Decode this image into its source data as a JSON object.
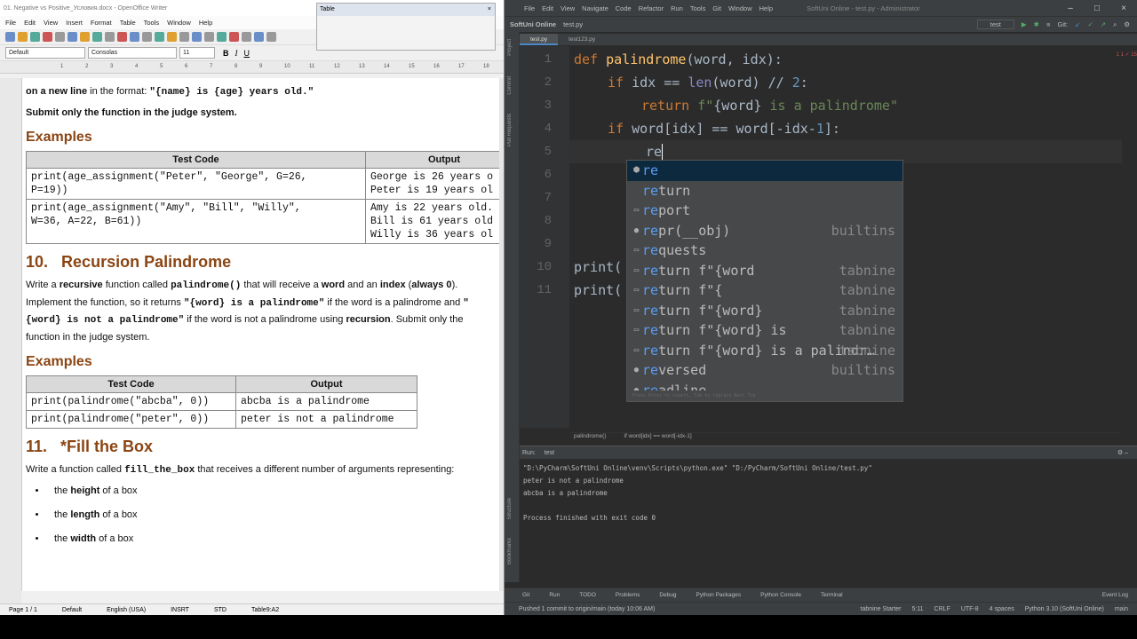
{
  "writer": {
    "title": "01. Negative vs Positive_Условия.docx - OpenOffice Writer",
    "menu": [
      "File",
      "Edit",
      "View",
      "Insert",
      "Format",
      "Table",
      "Tools",
      "Window",
      "Help"
    ],
    "style_box": "Default",
    "font_box": "Consolas",
    "size_box": "11",
    "table_toolbar_title": "Table",
    "doc": {
      "intro_a": "on a new line",
      "intro_b": " in the format: ",
      "intro_code": "\"{name} is {age} years old.\"",
      "submit1": "Submit only the function in the judge system.",
      "examples1": "Examples",
      "t1_head": [
        "Test Code",
        "Output"
      ],
      "t1_rows": [
        [
          "print(age_assignment(\"Peter\", \"George\", G=26,\nP=19))",
          "George is 26 years o\nPeter is 19 years ol"
        ],
        [
          "print(age_assignment(\"Amy\", \"Bill\", \"Willy\",\nW=36, A=22, B=61))",
          "Amy is 22 years old.\nBill is 61 years old\nWilly is 36 years ol"
        ]
      ],
      "h10_num": "10.",
      "h10_title": "Recursion Palindrome",
      "p10": [
        {
          "t": "Write a ",
          "c": ""
        },
        {
          "t": "recursive",
          "c": "b"
        },
        {
          "t": " function called ",
          "c": ""
        },
        {
          "t": "palindrome()",
          "c": "m"
        },
        {
          "t": " that will receive a ",
          "c": ""
        },
        {
          "t": "word",
          "c": "b"
        },
        {
          "t": " and an ",
          "c": ""
        },
        {
          "t": "index",
          "c": "b"
        },
        {
          "t": " (",
          "c": ""
        },
        {
          "t": "always 0",
          "c": "b"
        },
        {
          "t": "). Implement the function, so it returns ",
          "c": ""
        },
        {
          "t": "\"{word} is a palindrome\"",
          "c": "m"
        },
        {
          "t": " if the word is a palindrome and ",
          "c": ""
        },
        {
          "t": "\"{word} is not a palindrome\"",
          "c": "m"
        },
        {
          "t": " if the word is not a palindrome using ",
          "c": ""
        },
        {
          "t": "recursion",
          "c": "b"
        },
        {
          "t": ". Submit only the function in the judge system.",
          "c": ""
        }
      ],
      "examples2": "Examples",
      "t2_head": [
        "Test Code",
        "Output"
      ],
      "t2_rows": [
        [
          "print(palindrome(\"abcba\", 0))",
          "abcba is a palindrome"
        ],
        [
          "print(palindrome(\"peter\", 0))",
          "peter is not a palindrome"
        ]
      ],
      "h11_num": "11.",
      "h11_title": "*Fill the Box",
      "p11_a": "Write a function called ",
      "p11_code": "fill_the_box",
      "p11_b": " that receives a different number of arguments representing:",
      "bullets": [
        {
          "pre": "the ",
          "b": "height",
          "post": " of a box"
        },
        {
          "pre": "the ",
          "b": "length",
          "post": " of a box"
        },
        {
          "pre": "the ",
          "b": "width",
          "post": " of a box"
        }
      ]
    },
    "status": [
      "Page 1 / 1",
      "Default",
      "English (USA)",
      "INSRT",
      "STD",
      "Table9:A2"
    ]
  },
  "pycharm": {
    "menu": [
      "File",
      "Edit",
      "View",
      "Navigate",
      "Code",
      "Refactor",
      "Run",
      "Tools",
      "Git",
      "Window",
      "Help"
    ],
    "window_title": "SoftUni Online - test.py - Administrator",
    "project": "SoftUni Online",
    "file": "test.py",
    "run_config": "test",
    "git_label": "Git:",
    "tabs": [
      "test.py",
      "test123.py"
    ],
    "inspection": "1 1 ✓ 15",
    "gutter": [
      "1",
      "2",
      "3",
      "4",
      "5",
      "6",
      "7",
      "8",
      "9",
      "10",
      "11"
    ],
    "code": {
      "l1": [
        "def",
        "palindrome",
        "(word, idx):"
      ],
      "l2": [
        "if",
        " idx == ",
        "len",
        "(word) // ",
        "2",
        ":"
      ],
      "l3": [
        "return",
        " f\"",
        "{word}",
        " is a palindrome\""
      ],
      "l4": [
        "if",
        " word[idx] == word[-idx-",
        "1",
        "]:"
      ],
      "l5": "re",
      "l10": "print(",
      "l11": "print("
    },
    "completion": [
      {
        "icon": "⬢",
        "hl": "re",
        "rest": "",
        "src": ""
      },
      {
        "icon": "",
        "hl": "re",
        "rest": "turn",
        "src": ""
      },
      {
        "icon": "▭",
        "hl": "re",
        "rest": "port",
        "src": ""
      },
      {
        "icon": "●",
        "hl": "re",
        "rest": "pr(__obj)",
        "src": "builtins"
      },
      {
        "icon": "▭",
        "hl": "re",
        "rest": "quests",
        "src": ""
      },
      {
        "icon": "▭",
        "hl": "re",
        "rest": "turn f\"{word",
        "src": "tabnine"
      },
      {
        "icon": "▭",
        "hl": "re",
        "rest": "turn f\"{",
        "src": "tabnine"
      },
      {
        "icon": "▭",
        "hl": "re",
        "rest": "turn f\"{word}",
        "src": "tabnine"
      },
      {
        "icon": "▭",
        "hl": "re",
        "rest": "turn f\"{word} is",
        "src": "tabnine"
      },
      {
        "icon": "▭",
        "hl": "re",
        "rest": "turn f\"{word} is a palindr…",
        "src": "tabnine"
      },
      {
        "icon": "●",
        "hl": "re",
        "rest": "versed",
        "src": "builtins"
      },
      {
        "icon": "●",
        "hl": "re",
        "rest": "adline",
        "src": ""
      }
    ],
    "completion_footer": "Press Enter to insert, Tab to replace   Next Tip",
    "breadcrumb": [
      "palindrome()",
      "if word[idx] == word[-idx-1]"
    ],
    "run_label": "Run:",
    "run_tab": "test",
    "run_output": [
      "\"D:\\PyCharm\\SoftUni Online\\venv\\Scripts\\python.exe\" \"D:/PyCharm/SoftUni Online/test.py\"",
      "peter is not a palindrome",
      "abcba is a palindrome",
      "",
      "Process finished with exit code 0"
    ],
    "bottom_tabs": [
      "Git",
      "Run",
      "TODO",
      "Problems",
      "Debug",
      "Python Packages",
      "Python Console",
      "Terminal",
      "Event Log"
    ],
    "status_left": "Pushed 1 commit to origin/main (today 10:06 AM)",
    "status_right": [
      "tabnine Starter",
      "5:11",
      "CRLF",
      "UTF-8",
      "4 spaces",
      "Python 3.10 (SoftUni Online)",
      "main"
    ],
    "left_strip": [
      "Project",
      "Commit",
      "Pull Requests"
    ],
    "left_strip_bottom": [
      "Structure",
      "Bookmarks"
    ]
  }
}
